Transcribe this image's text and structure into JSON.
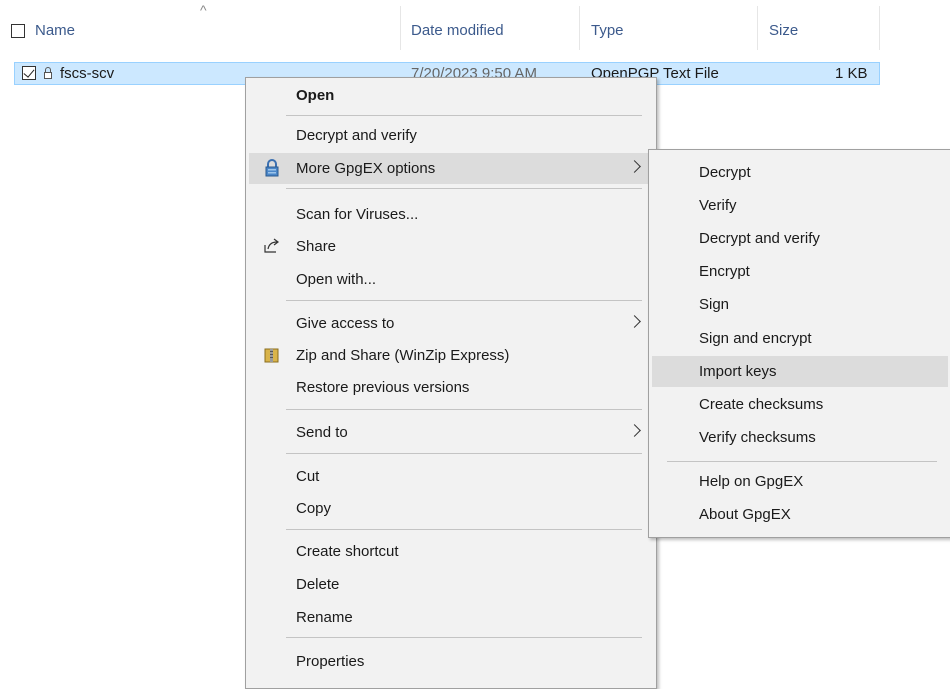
{
  "columns": {
    "name": "Name",
    "sort_indicator": "^",
    "date_modified": "Date modified",
    "type": "Type",
    "size": "Size"
  },
  "file": {
    "name": "fscs-scv",
    "date": "7/20/2023 9:50 AM",
    "type": "OpenPGP Text File",
    "size": "1 KB"
  },
  "context_menu": {
    "open": "Open",
    "decrypt_verify": "Decrypt and verify",
    "more_options": "More GpgEX options",
    "scan": "Scan for Viruses...",
    "share": "Share",
    "open_with": "Open with...",
    "give_access": "Give access to",
    "zip_share": "Zip and Share (WinZip Express)",
    "restore": "Restore previous versions",
    "send_to": "Send to",
    "cut": "Cut",
    "copy": "Copy",
    "create_shortcut": "Create shortcut",
    "delete": "Delete",
    "rename": "Rename",
    "properties": "Properties"
  },
  "submenu": {
    "decrypt": "Decrypt",
    "verify": "Verify",
    "decrypt_verify": "Decrypt and verify",
    "encrypt": "Encrypt",
    "sign": "Sign",
    "sign_encrypt": "Sign and encrypt",
    "import_keys": "Import keys",
    "create_checksums": "Create checksums",
    "verify_checksums": "Verify checksums",
    "help": "Help on GpgEX",
    "about": "About GpgEX"
  },
  "colors": {
    "selection_bg": "#cce8ff",
    "menu_bg": "#f2f2f2",
    "highlight": "#dcdcdc",
    "header_text": "#3c5a8c"
  }
}
